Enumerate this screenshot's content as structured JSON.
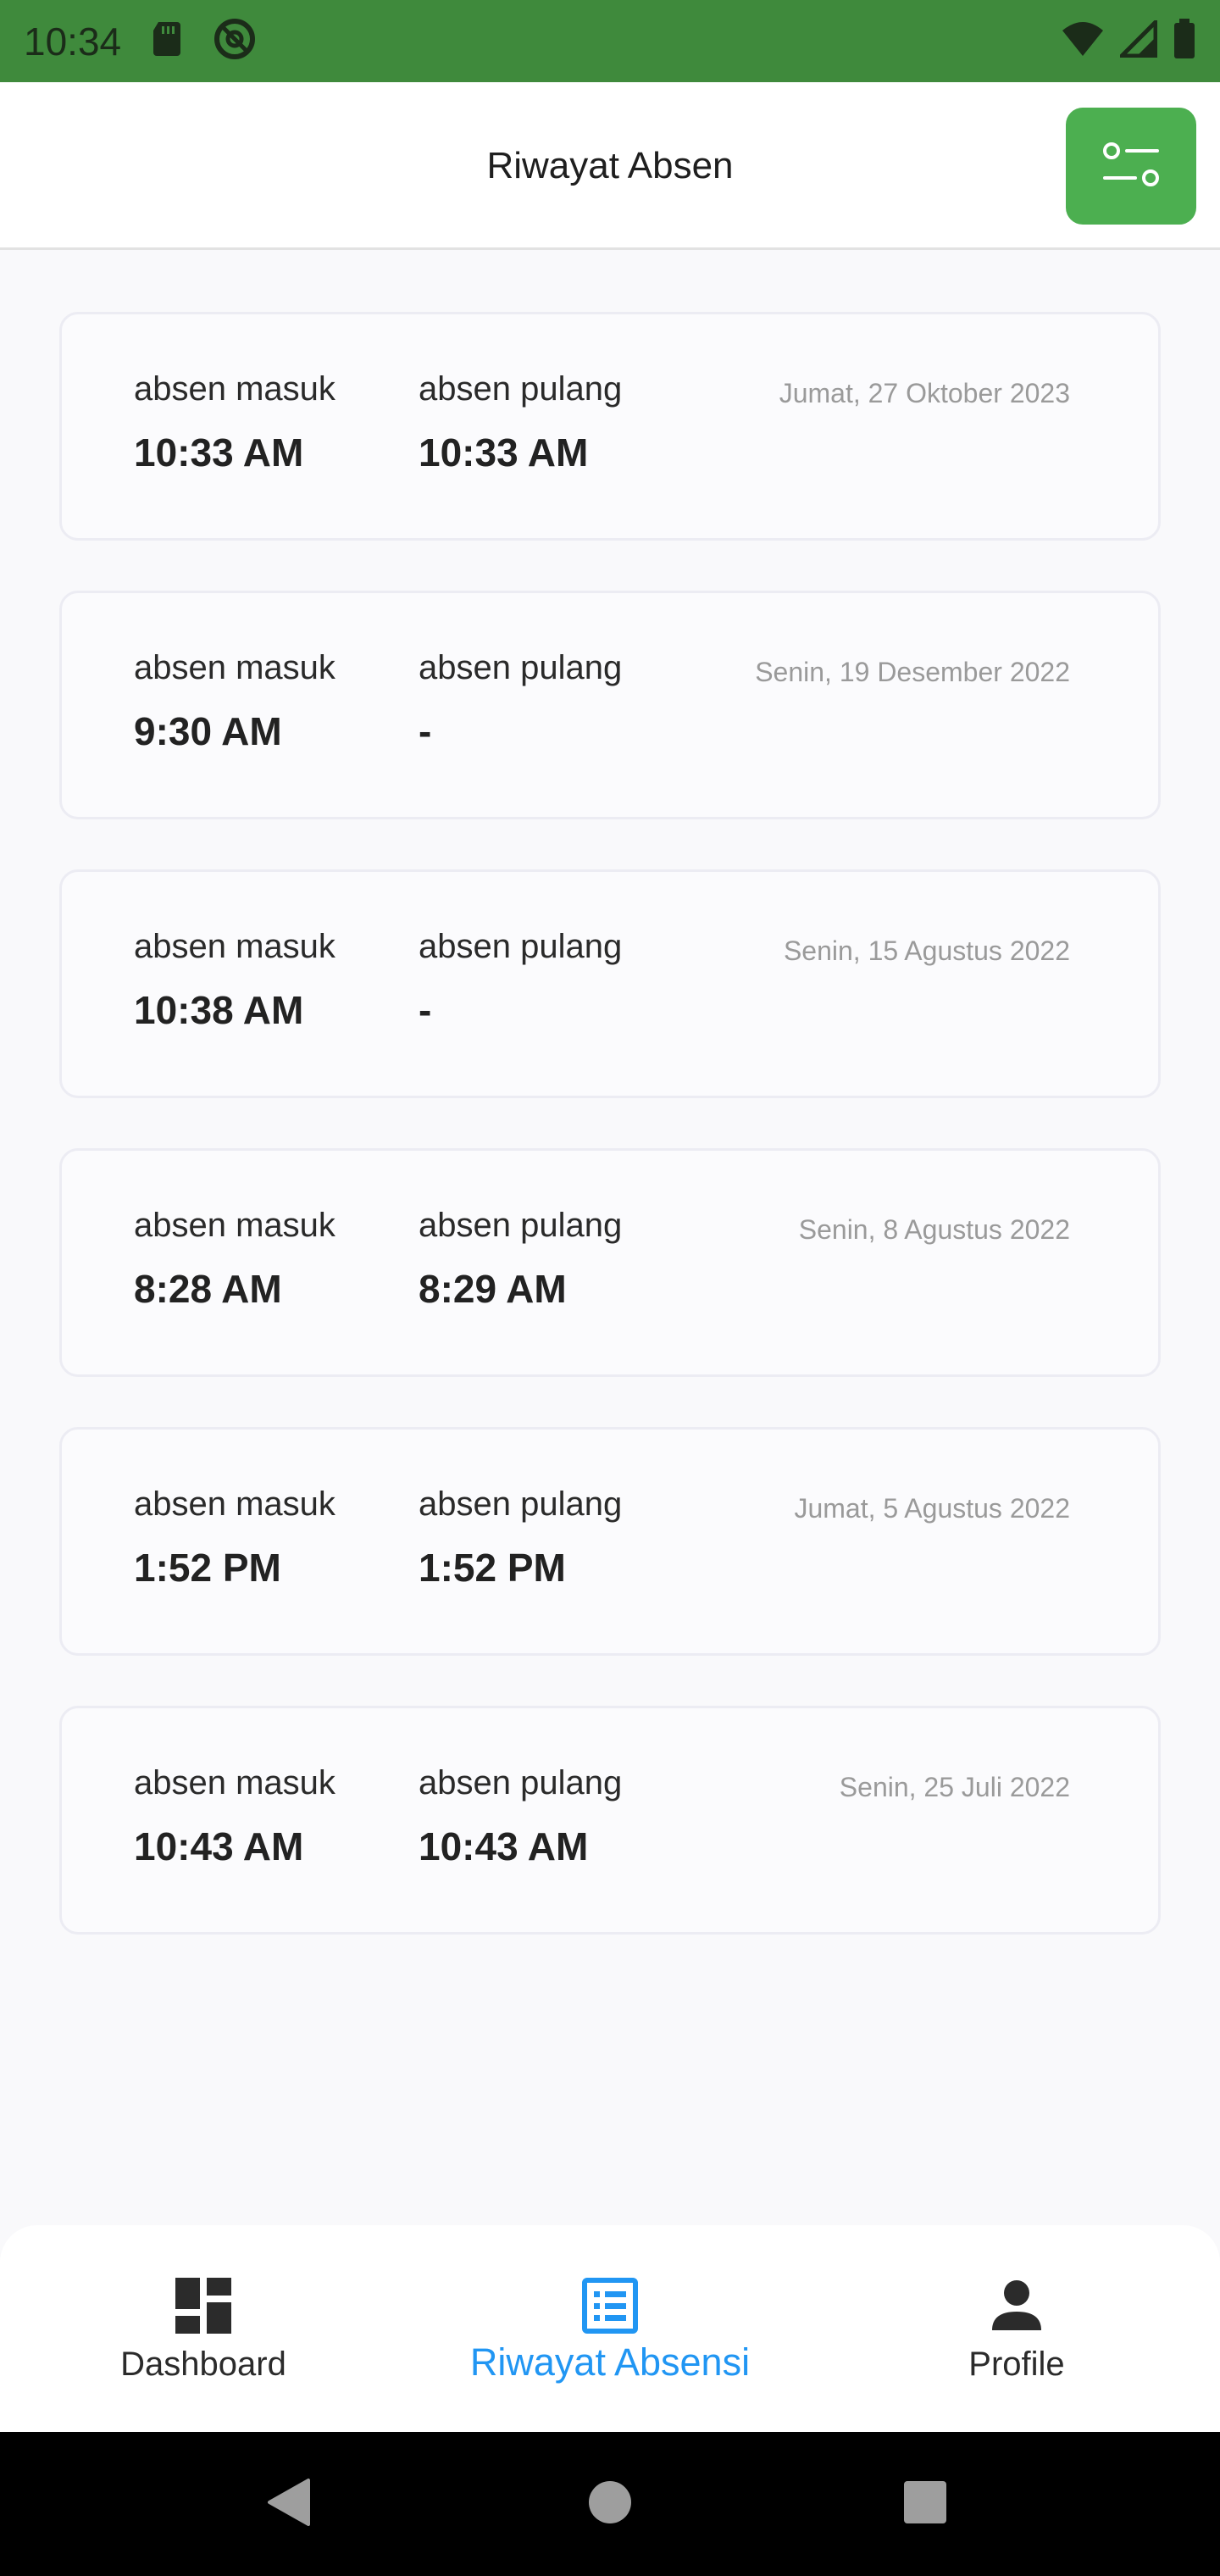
{
  "status_bar": {
    "time": "10:34",
    "icons": [
      "sd-card-icon",
      "at-sign-icon",
      "wifi-icon",
      "signal-icon",
      "battery-icon"
    ]
  },
  "app_bar": {
    "title": "Riwayat Absen",
    "filter_icon": "filter-settings-icon"
  },
  "records": [
    {
      "masuk_label": "absen masuk",
      "masuk_time": "10:33 AM",
      "pulang_label": "absen pulang",
      "pulang_time": "10:33 AM",
      "date": "Jumat, 27 Oktober 2023"
    },
    {
      "masuk_label": "absen masuk",
      "masuk_time": "9:30 AM",
      "pulang_label": "absen pulang",
      "pulang_time": "-",
      "date": "Senin, 19 Desember 2022"
    },
    {
      "masuk_label": "absen masuk",
      "masuk_time": "10:38 AM",
      "pulang_label": "absen pulang",
      "pulang_time": "-",
      "date": "Senin, 15 Agustus 2022"
    },
    {
      "masuk_label": "absen masuk",
      "masuk_time": "8:28 AM",
      "pulang_label": "absen pulang",
      "pulang_time": "8:29 AM",
      "date": "Senin, 8 Agustus 2022"
    },
    {
      "masuk_label": "absen masuk",
      "masuk_time": "1:52 PM",
      "pulang_label": "absen pulang",
      "pulang_time": "1:52 PM",
      "date": "Jumat, 5 Agustus 2022"
    },
    {
      "masuk_label": "absen masuk",
      "masuk_time": "10:43 AM",
      "pulang_label": "absen pulang",
      "pulang_time": "10:43 AM",
      "date": "Senin, 25 Juli 2022"
    }
  ],
  "bottom_nav": {
    "items": [
      {
        "label": "Dashboard",
        "icon": "dashboard-icon",
        "active": false
      },
      {
        "label": "Riwayat Absensi",
        "icon": "list-icon",
        "active": true
      },
      {
        "label": "Profile",
        "icon": "person-icon",
        "active": false
      }
    ]
  },
  "colors": {
    "status_bar": "#3f8a3c",
    "accent_green": "#4caf50",
    "active_tab": "#2196f3",
    "background": "#f9f9fb"
  }
}
